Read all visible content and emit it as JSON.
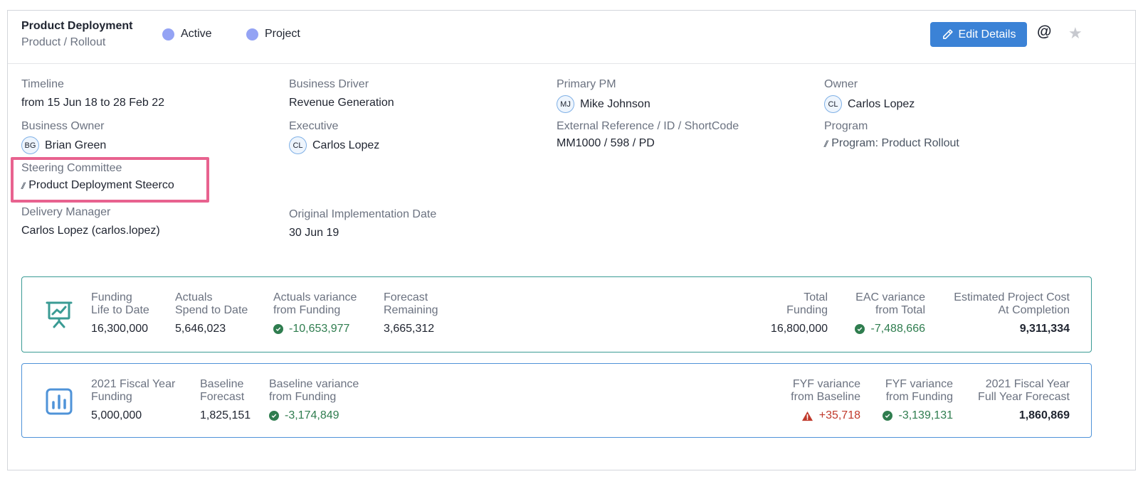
{
  "header": {
    "title": "Product Deployment",
    "subtitle": "Product / Rollout",
    "tags": [
      {
        "label": "Active"
      },
      {
        "label": "Project"
      }
    ],
    "edit_button": "Edit Details",
    "mention_icon": "@",
    "favorite_icon": "star-icon"
  },
  "fields": {
    "timeline": {
      "label": "Timeline",
      "value": "from 15 Jun 18 to 28 Feb 22"
    },
    "business_driver": {
      "label": "Business Driver",
      "value": "Revenue Generation"
    },
    "primary_pm": {
      "label": "Primary PM",
      "initials": "MJ",
      "value": "Mike Johnson"
    },
    "owner": {
      "label": "Owner",
      "initials": "CL",
      "value": "Carlos Lopez"
    },
    "business_owner": {
      "label": "Business Owner",
      "initials": "BG",
      "value": "Brian Green"
    },
    "executive": {
      "label": "Executive",
      "initials": "CL",
      "value": "Carlos Lopez"
    },
    "external_reference": {
      "label": "External Reference / ID / ShortCode",
      "value": "MM1000 / 598 / PD"
    },
    "program": {
      "label": "Program",
      "value": "Program: Product Rollout"
    },
    "steering_committee": {
      "label": "Steering Committee",
      "value": "Product Deployment Steerco"
    },
    "delivery_manager": {
      "label": "Delivery Manager",
      "value": "Carlos Lopez (carlos.lopez)"
    },
    "original_implementation_date": {
      "label": "Original Implementation Date",
      "value": "30 Jun 19"
    }
  },
  "funding_metrics": {
    "icon": "presentation-chart-icon",
    "items": [
      {
        "label1": "Funding",
        "label2": "Life to Date",
        "value": "16,300,000"
      },
      {
        "label1": "Actuals",
        "label2": "Spend to Date",
        "value": "5,646,023"
      },
      {
        "label1": "Actuals variance",
        "label2": "from Funding",
        "value": "-10,653,977",
        "status": "good"
      },
      {
        "label1": "Forecast",
        "label2": "Remaining",
        "value": "3,665,312"
      },
      {
        "label1": "Total",
        "label2": "Funding",
        "value": "16,800,000"
      },
      {
        "label1": "EAC variance",
        "label2": "from Total",
        "value": "-7,488,666",
        "status": "good"
      },
      {
        "label1": "Estimated Project Cost",
        "label2": "At Completion",
        "value": "9,311,334"
      }
    ]
  },
  "fiscal_metrics": {
    "icon": "bar-chart-icon",
    "items": [
      {
        "label1": "2021 Fiscal Year",
        "label2": "Funding",
        "value": "5,000,000"
      },
      {
        "label1": "Baseline",
        "label2": "Forecast",
        "value": "1,825,151"
      },
      {
        "label1": "Baseline variance",
        "label2": "from Funding",
        "value": "-3,174,849",
        "status": "good"
      },
      {
        "label1": "FYF variance",
        "label2": "from Baseline",
        "value": "+35,718",
        "status": "bad"
      },
      {
        "label1": "FYF variance",
        "label2": "from Funding",
        "value": "-3,139,131",
        "status": "good"
      },
      {
        "label1": "2021 Fiscal Year",
        "label2": "Full Year Forecast",
        "value": "1,860,869"
      }
    ]
  },
  "colors": {
    "accent": "#3b82d6",
    "tag_dot": "#94a3f4",
    "good": "#2f7d4f",
    "bad": "#c0392b",
    "highlight": "#e8628f"
  }
}
